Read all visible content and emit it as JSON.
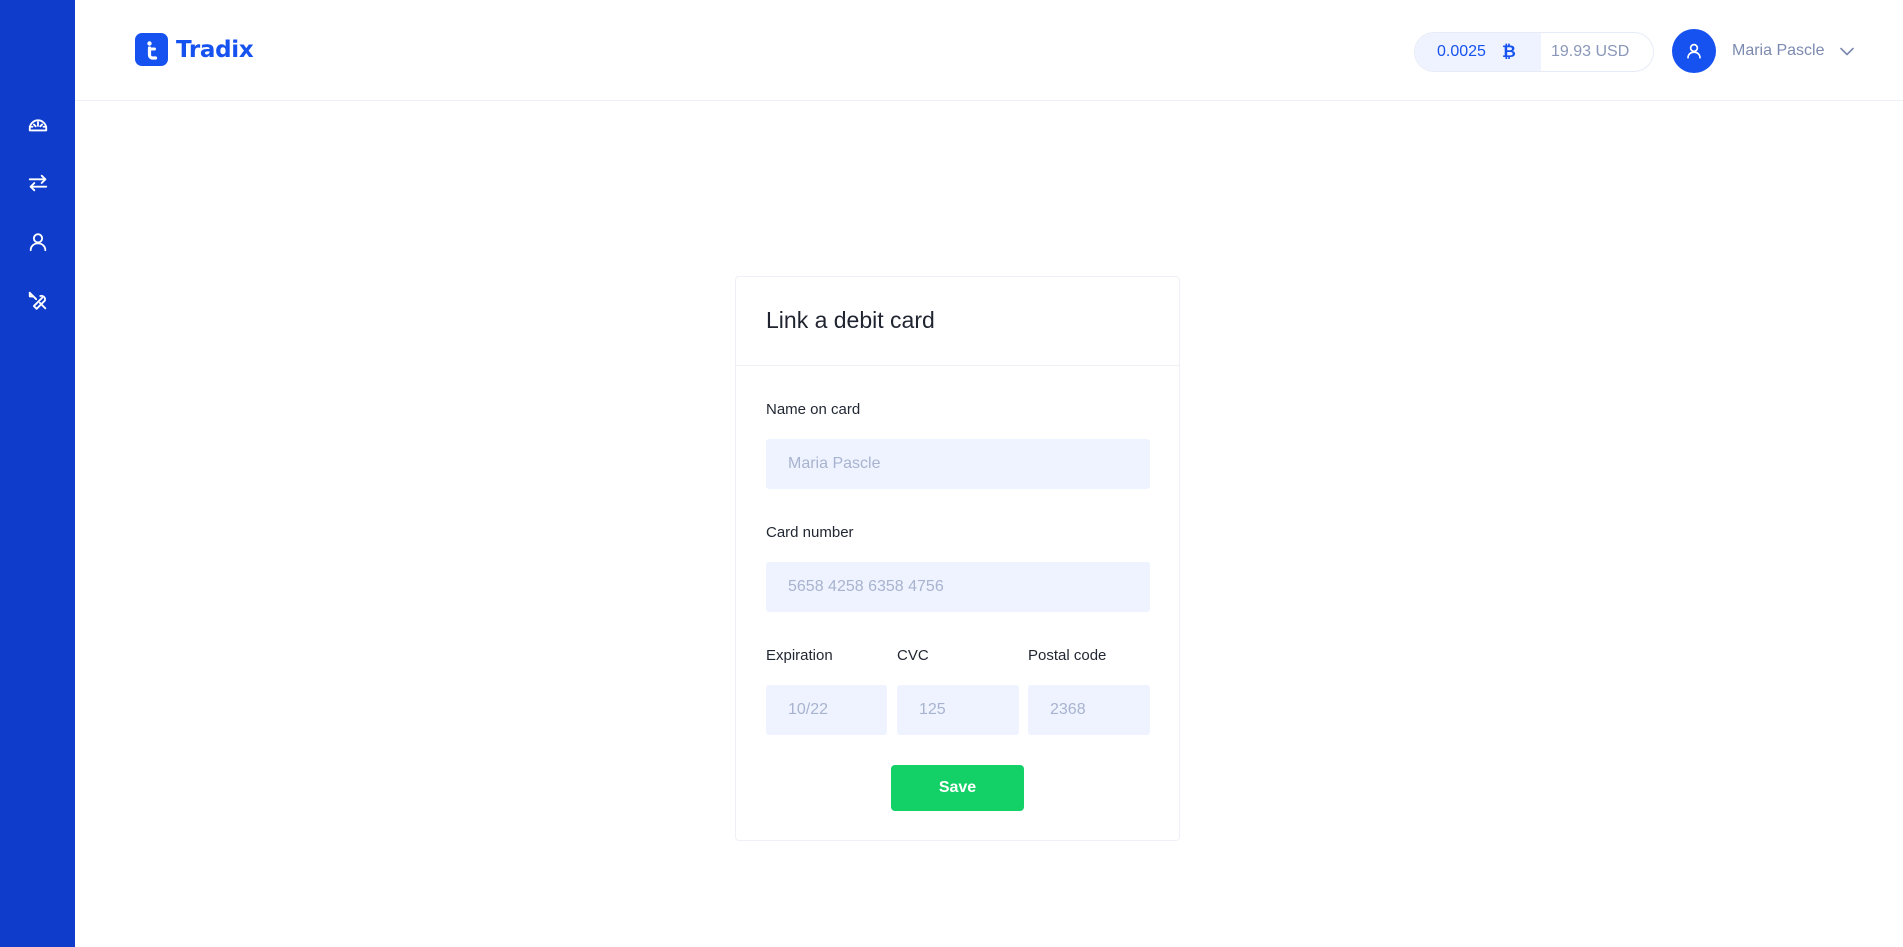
{
  "app": {
    "name": "Tradix"
  },
  "sidebar": {
    "items": [
      {
        "icon": "dashboard-icon"
      },
      {
        "icon": "exchange-icon"
      },
      {
        "icon": "user-icon"
      },
      {
        "icon": "tools-icon"
      }
    ]
  },
  "header": {
    "balance": {
      "crypto_amount": "0.0025",
      "crypto_symbol": "₿",
      "fiat_amount": "19.93 USD"
    },
    "user": {
      "name": "Maria Pascle"
    }
  },
  "form": {
    "title": "Link a debit card",
    "name_label": "Name on card",
    "name_placeholder": "Maria Pascle",
    "card_label": "Card number",
    "card_placeholder": "5658 4258 6358 4756",
    "expiration_label": "Expiration",
    "expiration_placeholder": "10/22",
    "cvc_label": "CVC",
    "cvc_placeholder": "125",
    "postal_label": "Postal code",
    "postal_placeholder": "2368",
    "save_label": "Save"
  },
  "colors": {
    "sidebar": "#0f3ccb",
    "brand": "#1652f0",
    "input_bg": "#eef3ff",
    "save_button": "#13d166"
  }
}
